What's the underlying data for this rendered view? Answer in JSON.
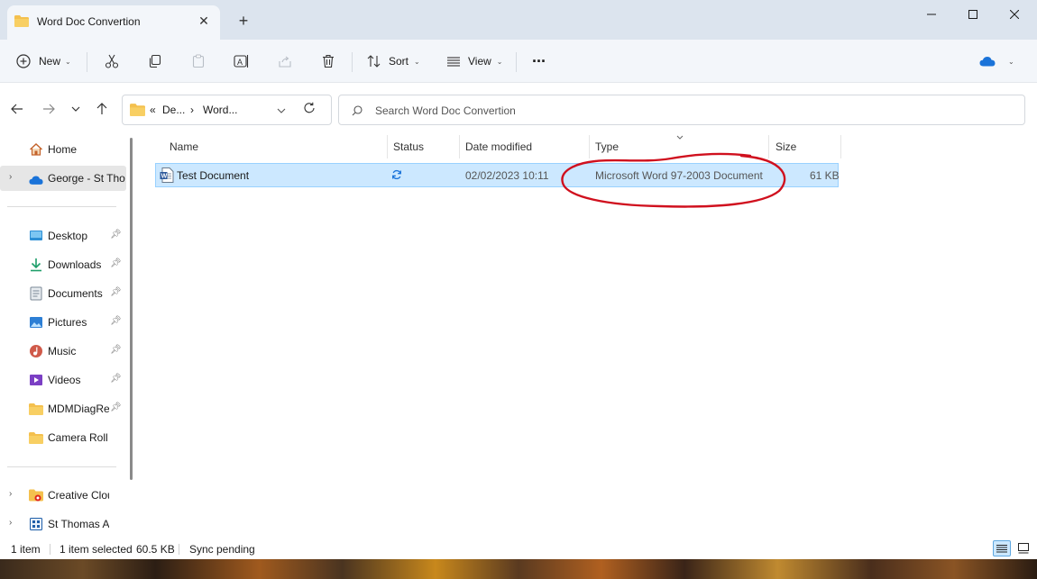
{
  "window": {
    "tab_title": "Word Doc Convertion",
    "tab_close": "✕",
    "new_tab": "+"
  },
  "toolbar": {
    "new_label": "New",
    "sort_label": "Sort",
    "view_label": "View",
    "more_label": "···",
    "icons": [
      "add-icon",
      "cut-icon",
      "copy-icon",
      "paste-icon",
      "rename-icon",
      "share-icon",
      "delete-icon",
      "sort-icon",
      "view-icon",
      "more-icon",
      "onedrive-icon"
    ]
  },
  "address": {
    "overflow": "«",
    "crumb1": "De...",
    "separator": "›",
    "crumb2": "Word...",
    "search_placeholder": "Search Word Doc Convertion"
  },
  "sidebar": {
    "home": "Home",
    "onedrive": "George - St Thomas",
    "quick": [
      {
        "label": "Desktop",
        "icon": "desktop-icon",
        "color": "#2d8fd5"
      },
      {
        "label": "Downloads",
        "icon": "download-icon",
        "color": "#1e9e6a"
      },
      {
        "label": "Documents",
        "icon": "documents-icon",
        "color": "#7a8796"
      },
      {
        "label": "Pictures",
        "icon": "pictures-icon",
        "color": "#2d7fd5"
      },
      {
        "label": "Music",
        "icon": "music-icon",
        "color": "#d05a4a"
      },
      {
        "label": "Videos",
        "icon": "videos-icon",
        "color": "#7b3fc4"
      },
      {
        "label": "MDMDiagReport",
        "icon": "folder-icon",
        "color": "#f4c04e"
      },
      {
        "label": "Camera Roll",
        "icon": "folder-icon",
        "color": "#f4c04e"
      }
    ],
    "drives": [
      {
        "label": "Creative Cloud Files"
      },
      {
        "label": "St Thomas Aquinas"
      }
    ]
  },
  "columns": {
    "name": "Name",
    "status": "Status",
    "date": "Date modified",
    "type": "Type",
    "size": "Size"
  },
  "files": [
    {
      "name": "Test Document",
      "status": "sync-pending",
      "date": "02/02/2023 10:11",
      "type": "Microsoft Word 97-2003 Document",
      "size": "61 KB"
    }
  ],
  "statusbar": {
    "count": "1 item",
    "selected": "1 item selected",
    "selected_size": "60.5 KB",
    "sync": "Sync pending"
  },
  "colors": {
    "selection": "#cce8ff",
    "annotation": "#d0101e",
    "folder": "#f4c04e"
  }
}
